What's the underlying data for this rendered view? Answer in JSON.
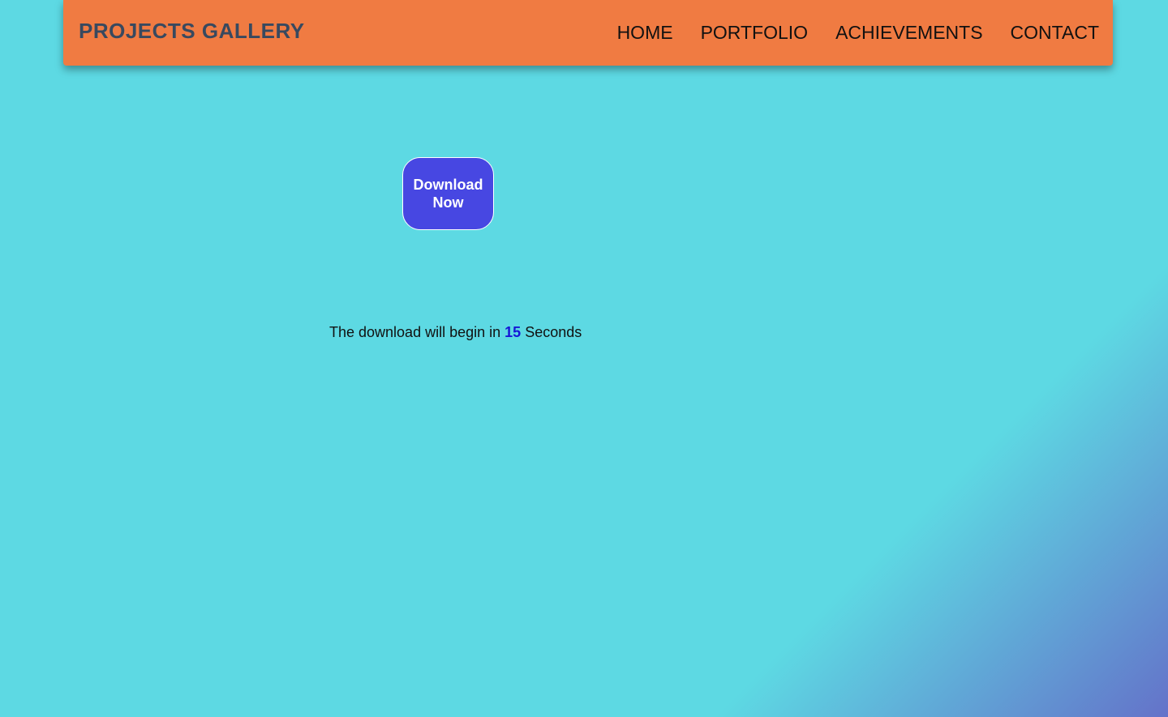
{
  "header": {
    "brand": "PROJECTS GALLERY",
    "nav": [
      {
        "label": "HOME"
      },
      {
        "label": "PORTFOLIO"
      },
      {
        "label": "ACHIEVEMENTS"
      },
      {
        "label": "CONTACT"
      }
    ]
  },
  "main": {
    "download_button_label": "Download Now",
    "countdown": {
      "prefix": "The download will begin in",
      "seconds": "15",
      "suffix": "Seconds"
    }
  },
  "colors": {
    "navbar": "#f07b42",
    "background": "#5dd9e3",
    "button": "#4747e2",
    "countdown_number": "#1616d6"
  }
}
